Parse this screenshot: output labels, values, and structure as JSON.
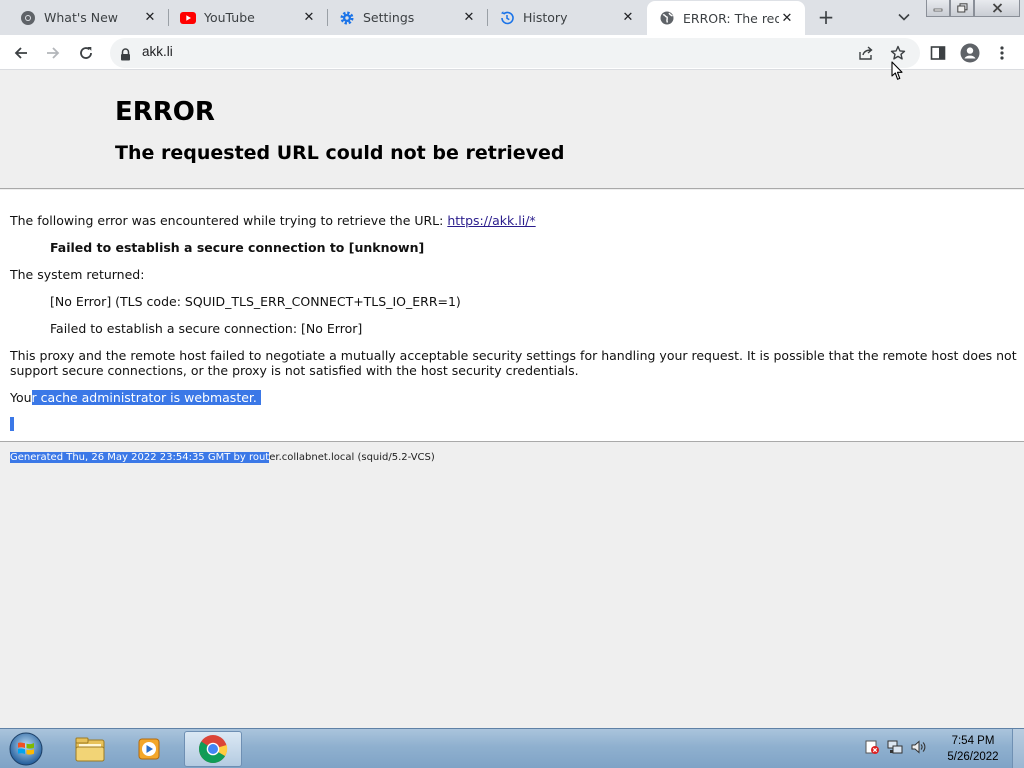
{
  "browser": {
    "tabs": [
      {
        "title": "What's New",
        "icon": "chrome-icon",
        "active": false
      },
      {
        "title": "YouTube",
        "icon": "youtube-icon",
        "active": false
      },
      {
        "title": "Settings",
        "icon": "gear-icon",
        "active": false
      },
      {
        "title": "History",
        "icon": "history-icon",
        "active": false
      },
      {
        "title": "ERROR: The reque",
        "icon": "globe-icon",
        "active": true
      }
    ],
    "close_glyph": "✕",
    "new_tab_glyph": "+",
    "address": "akk.li"
  },
  "page": {
    "title": "ERROR",
    "subtitle": "The requested URL could not be retrieved",
    "intro": "The following error was encountered while trying to retrieve the URL: ",
    "intro_url": "https://akk.li/*",
    "error_line": "Failed to establish a secure connection to [unknown]",
    "system_returned": "The system returned:",
    "tls_code": "[No Error] (TLS code: SQUID_TLS_ERR_CONNECT+TLS_IO_ERR=1)",
    "tls_detail": "Failed to establish a secure connection: [No Error]",
    "explanation_1": "This proxy and the remote host failed to negotiate a mutually acceptable security settings for handling your request. It is possible that the remote host does not",
    "explanation_2": "support secure connections, or the proxy is not satisfied with the host security credentials.",
    "admin_prefix": "You",
    "admin_selected": "r cache administrator is webmaster.",
    "footer_selected": "Generated Thu, 26 May 2022 23:54:35 GMT by rout",
    "footer_rest": "er.collabnet.local (squid/5.2-VCS)"
  },
  "taskbar": {
    "time": "7:54 PM",
    "date": "5/26/2022"
  },
  "colors": {
    "selection": "#3b78e7",
    "tabstrip": "#dee1e6",
    "taskbar": "#8fb0cf"
  }
}
